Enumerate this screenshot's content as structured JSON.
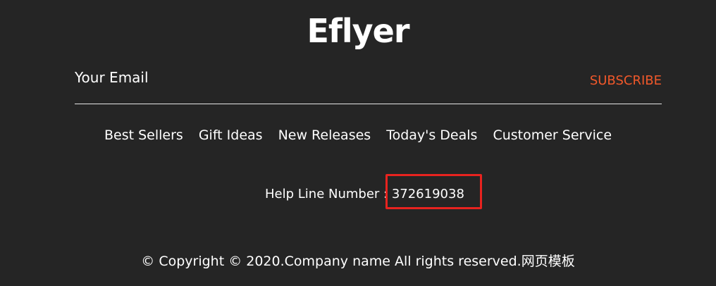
{
  "logo": {
    "text": "Eflyer"
  },
  "newsletter": {
    "email_placeholder": "Your Email",
    "subscribe_label": "SUBSCRIBE"
  },
  "nav": {
    "items": [
      {
        "label": "Best Sellers"
      },
      {
        "label": "Gift Ideas"
      },
      {
        "label": "New Releases"
      },
      {
        "label": "Today's Deals"
      },
      {
        "label": "Customer Service"
      }
    ]
  },
  "helpline": {
    "label": "Help Line Number",
    "separator": " : ",
    "number": "372619038"
  },
  "footer": {
    "copyright": "© Copyright © 2020.Company name All rights reserved.网页模板"
  },
  "colors": {
    "background": "#252525",
    "accent": "#f0582a",
    "highlight_box": "#e8231f"
  }
}
